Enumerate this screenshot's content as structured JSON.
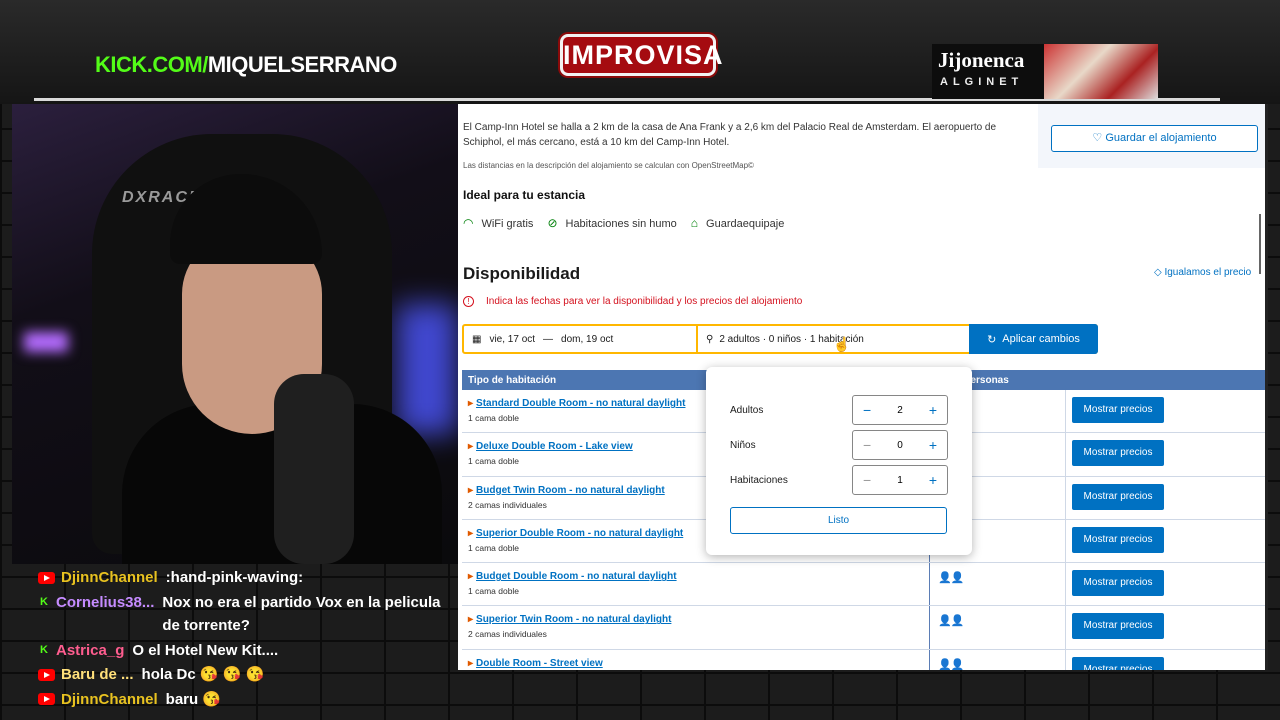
{
  "overlay": {
    "kick_prefix": "KICK.COM/",
    "kick_channel": "MIQUELSERRANO",
    "show_logo": "IMPROVISA",
    "sponsor_name": "Jijonenca",
    "sponsor_sub": "ALGINET",
    "chair_brand": "DXRACER"
  },
  "chat": [
    {
      "platform": "youtube",
      "user": "DjinnChannel",
      "user_color": "#e8c220",
      "message": ":hand-pink-waving:"
    },
    {
      "platform": "kick",
      "user": "Cornelius38...",
      "user_color": "#c58bff",
      "message": "Nox no era el partido Vox en la pelicula de torrente?"
    },
    {
      "platform": "kick",
      "user": "Astrica_g",
      "user_color": "#ff5d8f",
      "message": "O el Hotel New Kit...."
    },
    {
      "platform": "youtube",
      "user": "Baru de ...",
      "user_color": "#ffe07a",
      "message": "hola Dc 😘 😘 😘"
    },
    {
      "platform": "youtube",
      "user": "DjinnChannel",
      "user_color": "#e8c220",
      "message": "baru 😘"
    }
  ],
  "page": {
    "description": "El Camp-Inn Hotel se halla a 2 km de la casa de Ana Frank y a 2,6 km del Palacio Real de Amsterdam. El aeropuerto de Schiphol, el más cercano, está a 10 km del Camp-Inn Hotel.",
    "distance_note": "Las distancias en la descripción del alojamiento se calculan con OpenStreetMap©",
    "save_label": "Guardar el alojamiento",
    "ideal_title": "Ideal para tu estancia",
    "facilities": [
      "WiFi gratis",
      "Habitaciones sin humo",
      "Guardaequipaje"
    ],
    "availability_title": "Disponibilidad",
    "price_match": "Igualamos el precio",
    "warning": "Indica las fechas para ver la disponibilidad y los precios del alojamiento",
    "dates": {
      "checkin": "vie, 17 oct",
      "sep": "—",
      "checkout": "dom, 19 oct"
    },
    "guests_summary": "2 adultos · 0 niños · 1 habitación",
    "apply_label": "Aplicar cambios"
  },
  "table": {
    "headers": [
      "Tipo de habitación",
      "o de personas"
    ],
    "price_button": "Mostrar precios",
    "rows": [
      {
        "room": "Standard Double Room - no natural daylight",
        "beds": "1 cama doble",
        "persons": ""
      },
      {
        "room": "Deluxe Double Room - Lake view",
        "beds": "1 cama doble",
        "persons": ""
      },
      {
        "room": "Budget Twin Room - no natural daylight",
        "beds": "2 camas individuales",
        "persons": ""
      },
      {
        "room": "Superior Double Room - no natural daylight",
        "beds": "1 cama doble",
        "persons": ""
      },
      {
        "room": "Budget Double Room - no natural daylight",
        "beds": "1 cama doble",
        "persons": "👤👤"
      },
      {
        "room": "Superior Twin Room - no natural daylight",
        "beds": "2 camas individuales",
        "persons": "👤👤"
      },
      {
        "room": "Double Room - Street view",
        "beds": "",
        "persons": "👤👤"
      }
    ]
  },
  "guest_popup": {
    "adults_label": "Adultos",
    "adults": "2",
    "children_label": "Niños",
    "children": "0",
    "rooms_label": "Habitaciones",
    "rooms": "1",
    "done_label": "Listo"
  }
}
